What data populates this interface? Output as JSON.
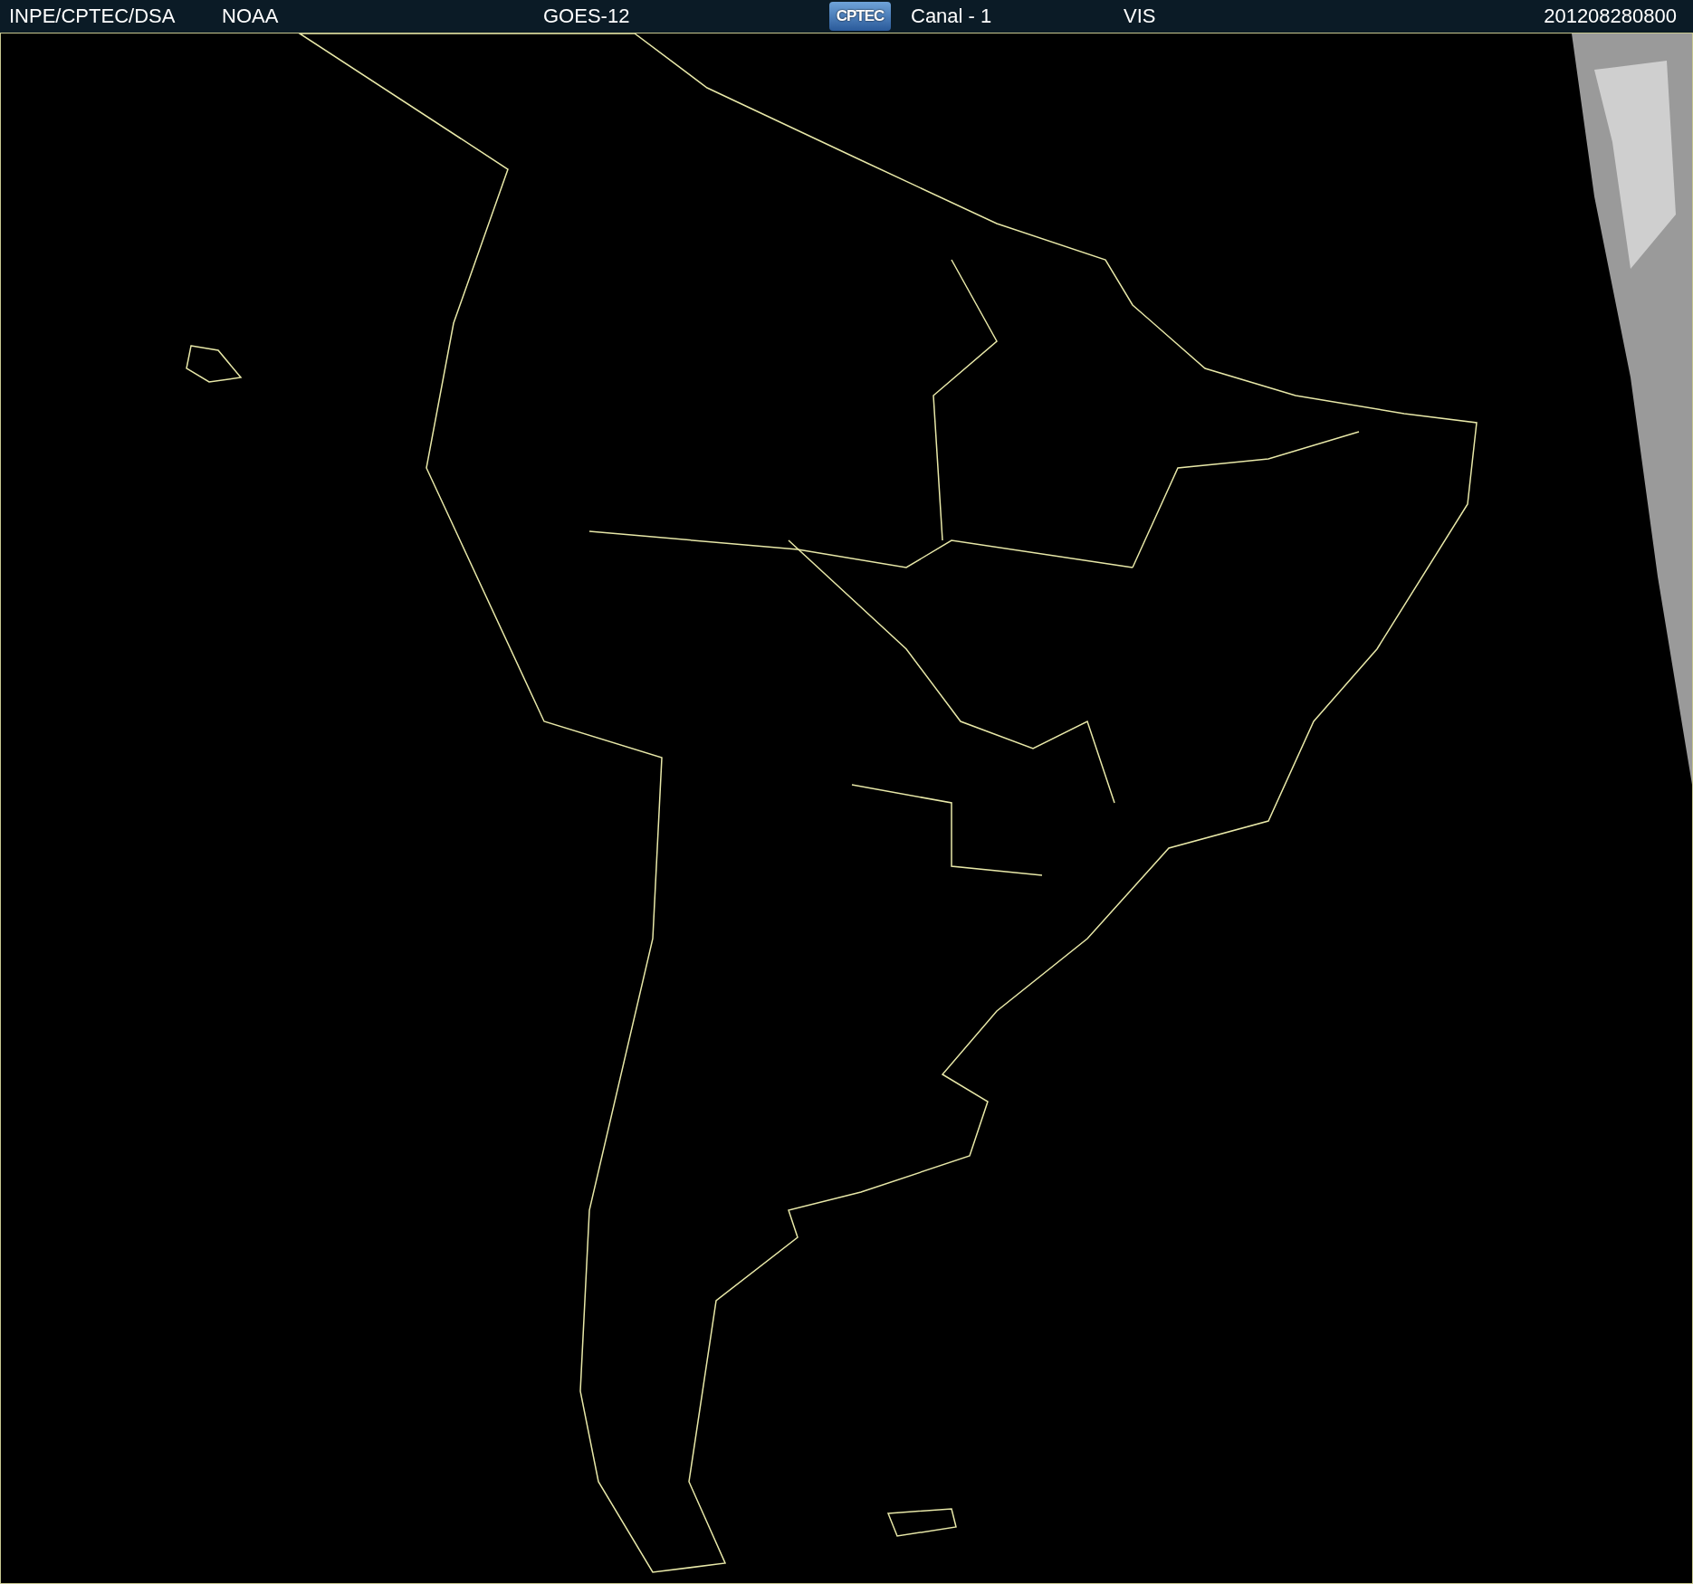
{
  "header": {
    "items": [
      {
        "kind": "text",
        "text": "INPE/CPTEC/DSA"
      },
      {
        "kind": "text",
        "text": "NOAA"
      },
      {
        "kind": "text",
        "text": "GOES-12"
      },
      {
        "kind": "logo",
        "text": "CPTEC"
      },
      {
        "kind": "text",
        "text": "Canal - 1"
      },
      {
        "kind": "text",
        "text": "VIS"
      },
      {
        "kind": "text",
        "text": "201208280800"
      }
    ]
  }
}
